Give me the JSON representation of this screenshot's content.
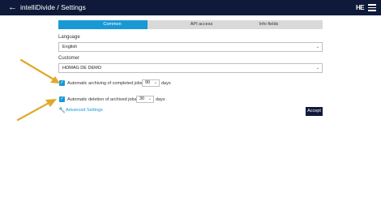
{
  "header": {
    "title": "intelliDivide / Settings",
    "logo_text": "HE"
  },
  "tabs": [
    {
      "label": "Common"
    },
    {
      "label": "API access"
    },
    {
      "label": "Info fields"
    }
  ],
  "language": {
    "label": "Language",
    "value": "English"
  },
  "customer": {
    "label": "Customer",
    "value": "HOMAG DE DEMO"
  },
  "archiving": {
    "prefix": "Automatic archiving of completed jobs after",
    "value": "90",
    "suffix": "days"
  },
  "deletion": {
    "prefix": "Automatic deletion of archived jobs after",
    "value": "30",
    "suffix": "days"
  },
  "advanced_settings": "Advanced Settings",
  "accept": "Accept",
  "colors": {
    "accent": "#1899d6",
    "navy": "#0f1a3a",
    "arrow": "#e1a92b"
  }
}
